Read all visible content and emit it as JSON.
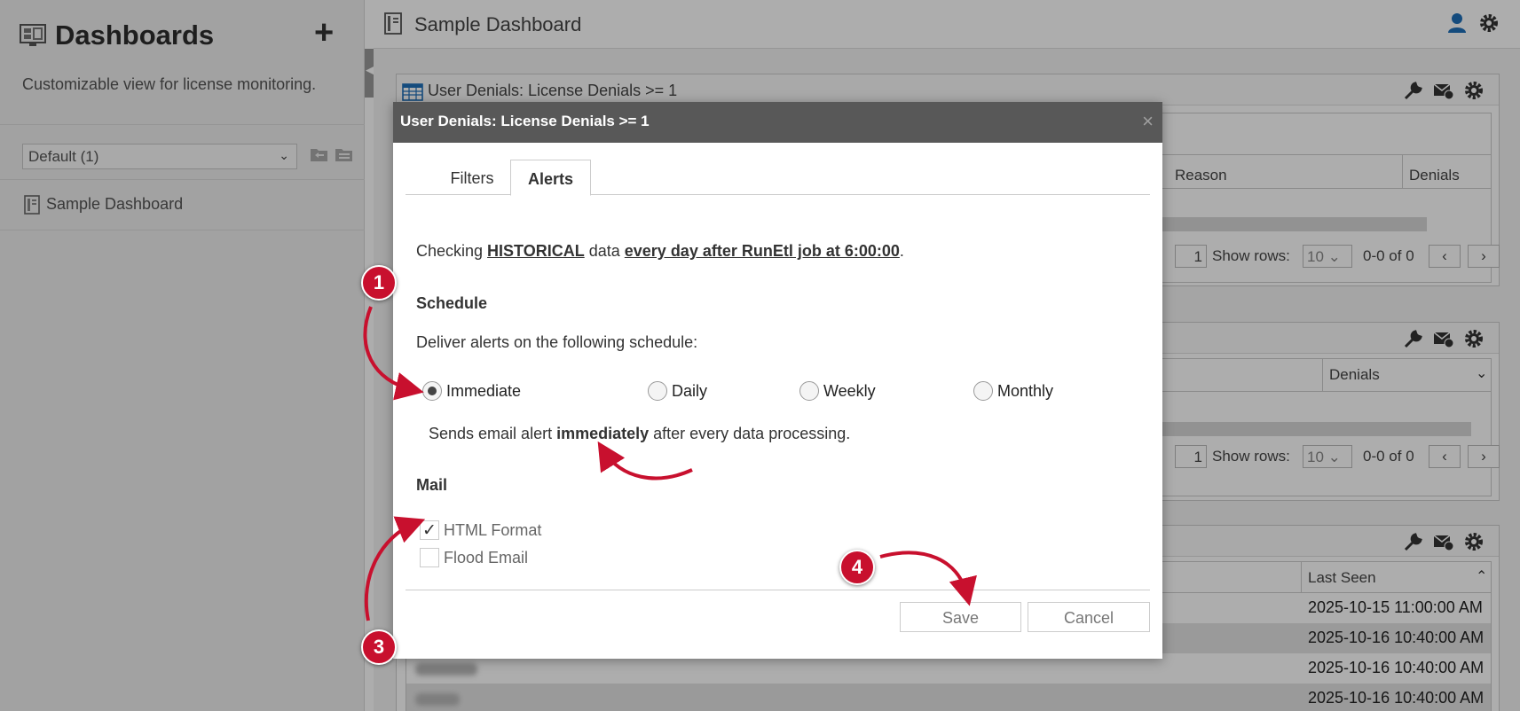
{
  "sidebar": {
    "title": "Dashboards",
    "add_label": "+",
    "description": "Customizable view for license monitoring.",
    "dashboard_select": {
      "value": "Default (1)"
    },
    "items": [
      {
        "label": "Sample Dashboard"
      }
    ]
  },
  "header": {
    "title": "Sample Dashboard"
  },
  "widgets": {
    "w1": {
      "title": "User Denials: License Denials >= 1",
      "columns": [
        "Reason",
        "Denials"
      ],
      "pager": {
        "page": "1",
        "show_rows_label": "Show rows:",
        "rows_value": "10",
        "range": "0-0 of 0"
      }
    },
    "w2": {
      "columns": [
        "Denials"
      ],
      "pager": {
        "page": "1",
        "show_rows_label": "Show rows:",
        "rows_value": "10",
        "range": "0-0 of 0"
      }
    },
    "w3": {
      "columns": [
        "Last Seen"
      ],
      "rows": [
        "2025-10-15 11:00:00 AM",
        "2025-10-16 10:40:00 AM",
        "2025-10-16 10:40:00 AM",
        "2025-10-16 10:40:00 AM"
      ]
    }
  },
  "modal": {
    "title": "User Denials: License Denials >= 1",
    "close": "×",
    "tabs": [
      {
        "label": "Filters"
      },
      {
        "label": "Alerts"
      }
    ],
    "active_tab": "Alerts",
    "info": {
      "prefix": "Checking ",
      "data_type": "HISTORICAL",
      "middle": " data ",
      "schedule_text": "every day after RunEtl job at 6:00:00",
      "suffix": "."
    },
    "schedule_heading": "Schedule",
    "deliver_text": "Deliver alerts on the following schedule:",
    "schedule_options": [
      {
        "label": "Immediate",
        "selected": true
      },
      {
        "label": "Daily",
        "selected": false
      },
      {
        "label": "Weekly",
        "selected": false
      },
      {
        "label": "Monthly",
        "selected": false
      }
    ],
    "sends": {
      "prefix": "Sends email alert ",
      "emphasis": "immediately",
      "suffix": " after every data processing."
    },
    "mail_heading": "Mail",
    "mail_options": [
      {
        "label": "HTML Format",
        "checked": true
      },
      {
        "label": "Flood Email",
        "checked": false
      }
    ],
    "save_label": "Save",
    "cancel_label": "Cancel"
  },
  "annotations": {
    "badges": [
      "1",
      "3",
      "4"
    ],
    "color": "#c8102e"
  },
  "colors": {
    "modal_header": "#585858",
    "accent_blue": "#1e6fb8"
  }
}
